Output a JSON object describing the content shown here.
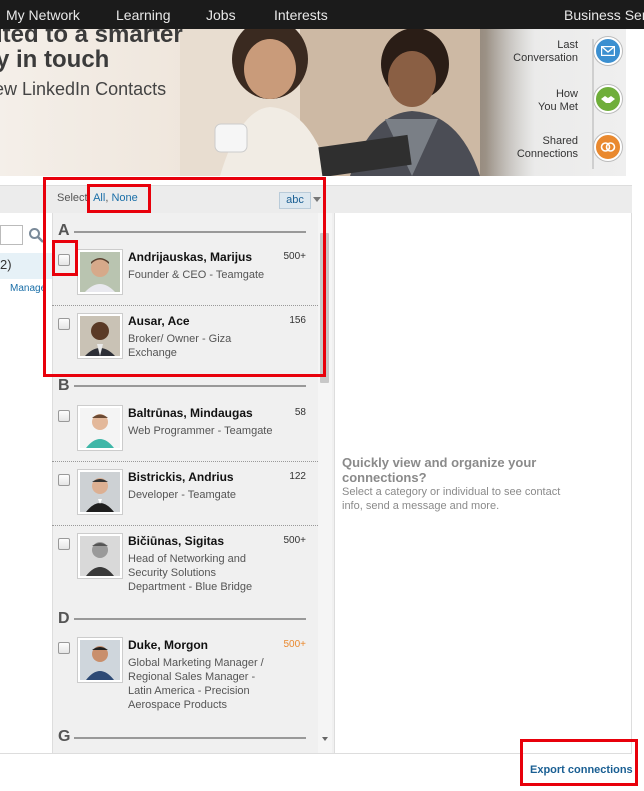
{
  "nav": {
    "items": [
      "My Network",
      "Learning",
      "Jobs",
      "Interests",
      "Business Serv"
    ]
  },
  "hero": {
    "line1": "ited to a smarter",
    "line2": "y in touch",
    "line3": "ew LinkedIn Contacts",
    "steps": [
      {
        "label_a": "Last",
        "label_b": "Conversation",
        "color": "#3b8fd0",
        "icon": "envelope-icon"
      },
      {
        "label_a": "How",
        "label_b": "You Met",
        "color": "#6fae3a",
        "icon": "handshake-icon"
      },
      {
        "label_a": "Shared",
        "label_b": "Connections",
        "color": "#e9892f",
        "icon": "rings-icon"
      }
    ]
  },
  "left": {
    "selected_fragment": "2)",
    "manage_fragment": "Manage"
  },
  "list": {
    "select_prefix": "Select:",
    "select_all": "All",
    "select_sep": ", ",
    "select_none": "None",
    "sort_label": "abc",
    "letters": [
      "A",
      "B",
      "D",
      "G"
    ],
    "contacts": [
      {
        "name": "Andrijauskas, Marijus",
        "title": "Founder & CEO - Teamgate",
        "count": "500+"
      },
      {
        "name": "Ausar, Ace",
        "title": "Broker/ Owner - Giza Exchange",
        "count": "156"
      },
      {
        "name": "Baltrūnas, Mindaugas",
        "title": "Web Programmer - Teamgate",
        "count": "58"
      },
      {
        "name": "Bistrickis, Andrius",
        "title": "Developer - Teamgate",
        "count": "122"
      },
      {
        "name": "Bičiūnas, Sigitas",
        "title": "Head of Networking and Security Solutions Department - Blue Bridge",
        "count": "500+"
      },
      {
        "name": "Duke, Morgon",
        "title": "Global Marketing Manager / Regional Sales Manager - Latin America - Precision Aerospace Products",
        "count": "500+"
      }
    ]
  },
  "detail": {
    "heading": "Quickly view and organize your connections?",
    "sub": "Select a category or individual to see contact info, send a message and more."
  },
  "footer": {
    "export_label": "Export connections"
  },
  "colors": {
    "annotation": "#e8000b",
    "link": "#1a6fa8",
    "count_orange": "#e9892f"
  }
}
